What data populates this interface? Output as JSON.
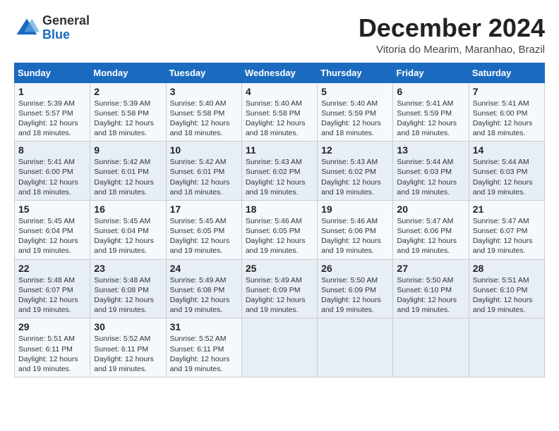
{
  "logo": {
    "general": "General",
    "blue": "Blue"
  },
  "title": "December 2024",
  "subtitle": "Vitoria do Mearim, Maranhao, Brazil",
  "days_header": [
    "Sunday",
    "Monday",
    "Tuesday",
    "Wednesday",
    "Thursday",
    "Friday",
    "Saturday"
  ],
  "weeks": [
    [
      {
        "day": "1",
        "info": "Sunrise: 5:39 AM\nSunset: 5:57 PM\nDaylight: 12 hours\nand 18 minutes."
      },
      {
        "day": "2",
        "info": "Sunrise: 5:39 AM\nSunset: 5:58 PM\nDaylight: 12 hours\nand 18 minutes."
      },
      {
        "day": "3",
        "info": "Sunrise: 5:40 AM\nSunset: 5:58 PM\nDaylight: 12 hours\nand 18 minutes."
      },
      {
        "day": "4",
        "info": "Sunrise: 5:40 AM\nSunset: 5:58 PM\nDaylight: 12 hours\nand 18 minutes."
      },
      {
        "day": "5",
        "info": "Sunrise: 5:40 AM\nSunset: 5:59 PM\nDaylight: 12 hours\nand 18 minutes."
      },
      {
        "day": "6",
        "info": "Sunrise: 5:41 AM\nSunset: 5:59 PM\nDaylight: 12 hours\nand 18 minutes."
      },
      {
        "day": "7",
        "info": "Sunrise: 5:41 AM\nSunset: 6:00 PM\nDaylight: 12 hours\nand 18 minutes."
      }
    ],
    [
      {
        "day": "8",
        "info": "Sunrise: 5:41 AM\nSunset: 6:00 PM\nDaylight: 12 hours\nand 18 minutes."
      },
      {
        "day": "9",
        "info": "Sunrise: 5:42 AM\nSunset: 6:01 PM\nDaylight: 12 hours\nand 18 minutes."
      },
      {
        "day": "10",
        "info": "Sunrise: 5:42 AM\nSunset: 6:01 PM\nDaylight: 12 hours\nand 18 minutes."
      },
      {
        "day": "11",
        "info": "Sunrise: 5:43 AM\nSunset: 6:02 PM\nDaylight: 12 hours\nand 19 minutes."
      },
      {
        "day": "12",
        "info": "Sunrise: 5:43 AM\nSunset: 6:02 PM\nDaylight: 12 hours\nand 19 minutes."
      },
      {
        "day": "13",
        "info": "Sunrise: 5:44 AM\nSunset: 6:03 PM\nDaylight: 12 hours\nand 19 minutes."
      },
      {
        "day": "14",
        "info": "Sunrise: 5:44 AM\nSunset: 6:03 PM\nDaylight: 12 hours\nand 19 minutes."
      }
    ],
    [
      {
        "day": "15",
        "info": "Sunrise: 5:45 AM\nSunset: 6:04 PM\nDaylight: 12 hours\nand 19 minutes."
      },
      {
        "day": "16",
        "info": "Sunrise: 5:45 AM\nSunset: 6:04 PM\nDaylight: 12 hours\nand 19 minutes."
      },
      {
        "day": "17",
        "info": "Sunrise: 5:45 AM\nSunset: 6:05 PM\nDaylight: 12 hours\nand 19 minutes."
      },
      {
        "day": "18",
        "info": "Sunrise: 5:46 AM\nSunset: 6:05 PM\nDaylight: 12 hours\nand 19 minutes."
      },
      {
        "day": "19",
        "info": "Sunrise: 5:46 AM\nSunset: 6:06 PM\nDaylight: 12 hours\nand 19 minutes."
      },
      {
        "day": "20",
        "info": "Sunrise: 5:47 AM\nSunset: 6:06 PM\nDaylight: 12 hours\nand 19 minutes."
      },
      {
        "day": "21",
        "info": "Sunrise: 5:47 AM\nSunset: 6:07 PM\nDaylight: 12 hours\nand 19 minutes."
      }
    ],
    [
      {
        "day": "22",
        "info": "Sunrise: 5:48 AM\nSunset: 6:07 PM\nDaylight: 12 hours\nand 19 minutes."
      },
      {
        "day": "23",
        "info": "Sunrise: 5:48 AM\nSunset: 6:08 PM\nDaylight: 12 hours\nand 19 minutes."
      },
      {
        "day": "24",
        "info": "Sunrise: 5:49 AM\nSunset: 6:08 PM\nDaylight: 12 hours\nand 19 minutes."
      },
      {
        "day": "25",
        "info": "Sunrise: 5:49 AM\nSunset: 6:09 PM\nDaylight: 12 hours\nand 19 minutes."
      },
      {
        "day": "26",
        "info": "Sunrise: 5:50 AM\nSunset: 6:09 PM\nDaylight: 12 hours\nand 19 minutes."
      },
      {
        "day": "27",
        "info": "Sunrise: 5:50 AM\nSunset: 6:10 PM\nDaylight: 12 hours\nand 19 minutes."
      },
      {
        "day": "28",
        "info": "Sunrise: 5:51 AM\nSunset: 6:10 PM\nDaylight: 12 hours\nand 19 minutes."
      }
    ],
    [
      {
        "day": "29",
        "info": "Sunrise: 5:51 AM\nSunset: 6:11 PM\nDaylight: 12 hours\nand 19 minutes."
      },
      {
        "day": "30",
        "info": "Sunrise: 5:52 AM\nSunset: 6:11 PM\nDaylight: 12 hours\nand 19 minutes."
      },
      {
        "day": "31",
        "info": "Sunrise: 5:52 AM\nSunset: 6:11 PM\nDaylight: 12 hours\nand 19 minutes."
      },
      {
        "day": "",
        "info": ""
      },
      {
        "day": "",
        "info": ""
      },
      {
        "day": "",
        "info": ""
      },
      {
        "day": "",
        "info": ""
      }
    ]
  ],
  "accent_color": "#1a6bbf"
}
